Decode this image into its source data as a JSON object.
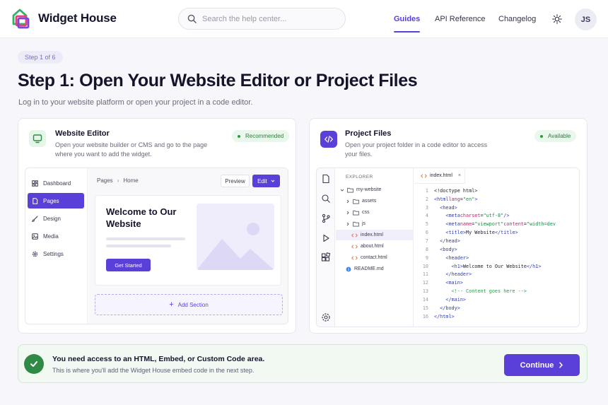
{
  "brand": {
    "name": "Widget House",
    "accent": "#5b3fd9",
    "success": "#2e8a44"
  },
  "header": {
    "search_placeholder": "Search the help center...",
    "nav": [
      {
        "label": "Guides",
        "active": true
      },
      {
        "label": "API Reference"
      },
      {
        "label": "Changelog"
      }
    ],
    "theme_icon": "sun-icon",
    "avatar_initials": "JS"
  },
  "step": {
    "badge": "Step 1 of 6",
    "title": "Step 1: Open Your Website Editor or Project Files",
    "subtitle": "Log in to your website platform or open your project in a code editor."
  },
  "website_editor": {
    "icon": "monitor-icon",
    "title": "Website Editor",
    "description": "Open your website builder or CMS and go to the page where you want to add the widget.",
    "chip": "Recommended",
    "sidebar": [
      {
        "label": "Dashboard",
        "icon": "dashboard-icon"
      },
      {
        "label": "Pages",
        "icon": "page-icon",
        "active": true
      },
      {
        "label": "Design",
        "icon": "brush-icon"
      },
      {
        "label": "Media",
        "icon": "image-icon"
      },
      {
        "label": "Settings",
        "icon": "gear-icon"
      }
    ],
    "breadcrumb": [
      "Pages",
      "Home"
    ],
    "preview_label": "Preview",
    "edit_label": "Edit",
    "canvas_heading": "Welcome to Our Website",
    "cta_label": "Get Started",
    "add_section_label": "Add Section"
  },
  "project_files": {
    "icon": "code-icon",
    "title": "Project Files",
    "description": "Open your project folder in a code editor to access your files.",
    "chip": "Available",
    "explorer_label": "EXPLORER",
    "tree": [
      {
        "label": "my-website",
        "type": "folder-open"
      },
      {
        "label": "assets",
        "type": "folder"
      },
      {
        "label": "css",
        "type": "folder"
      },
      {
        "label": "js",
        "type": "folder"
      },
      {
        "label": "index.html",
        "type": "html",
        "selected": true
      },
      {
        "label": "about.html",
        "type": "html"
      },
      {
        "label": "contact.html",
        "type": "html"
      },
      {
        "label": "README.md",
        "type": "info"
      }
    ],
    "tab_label": "index.html",
    "tab_close": "×"
  },
  "requirement": {
    "title": "You need access to an HTML, Embed, or Custom Code area.",
    "subtitle": "This is where you'll add the Widget House embed code in the next step.",
    "continue_label": "Continue"
  }
}
